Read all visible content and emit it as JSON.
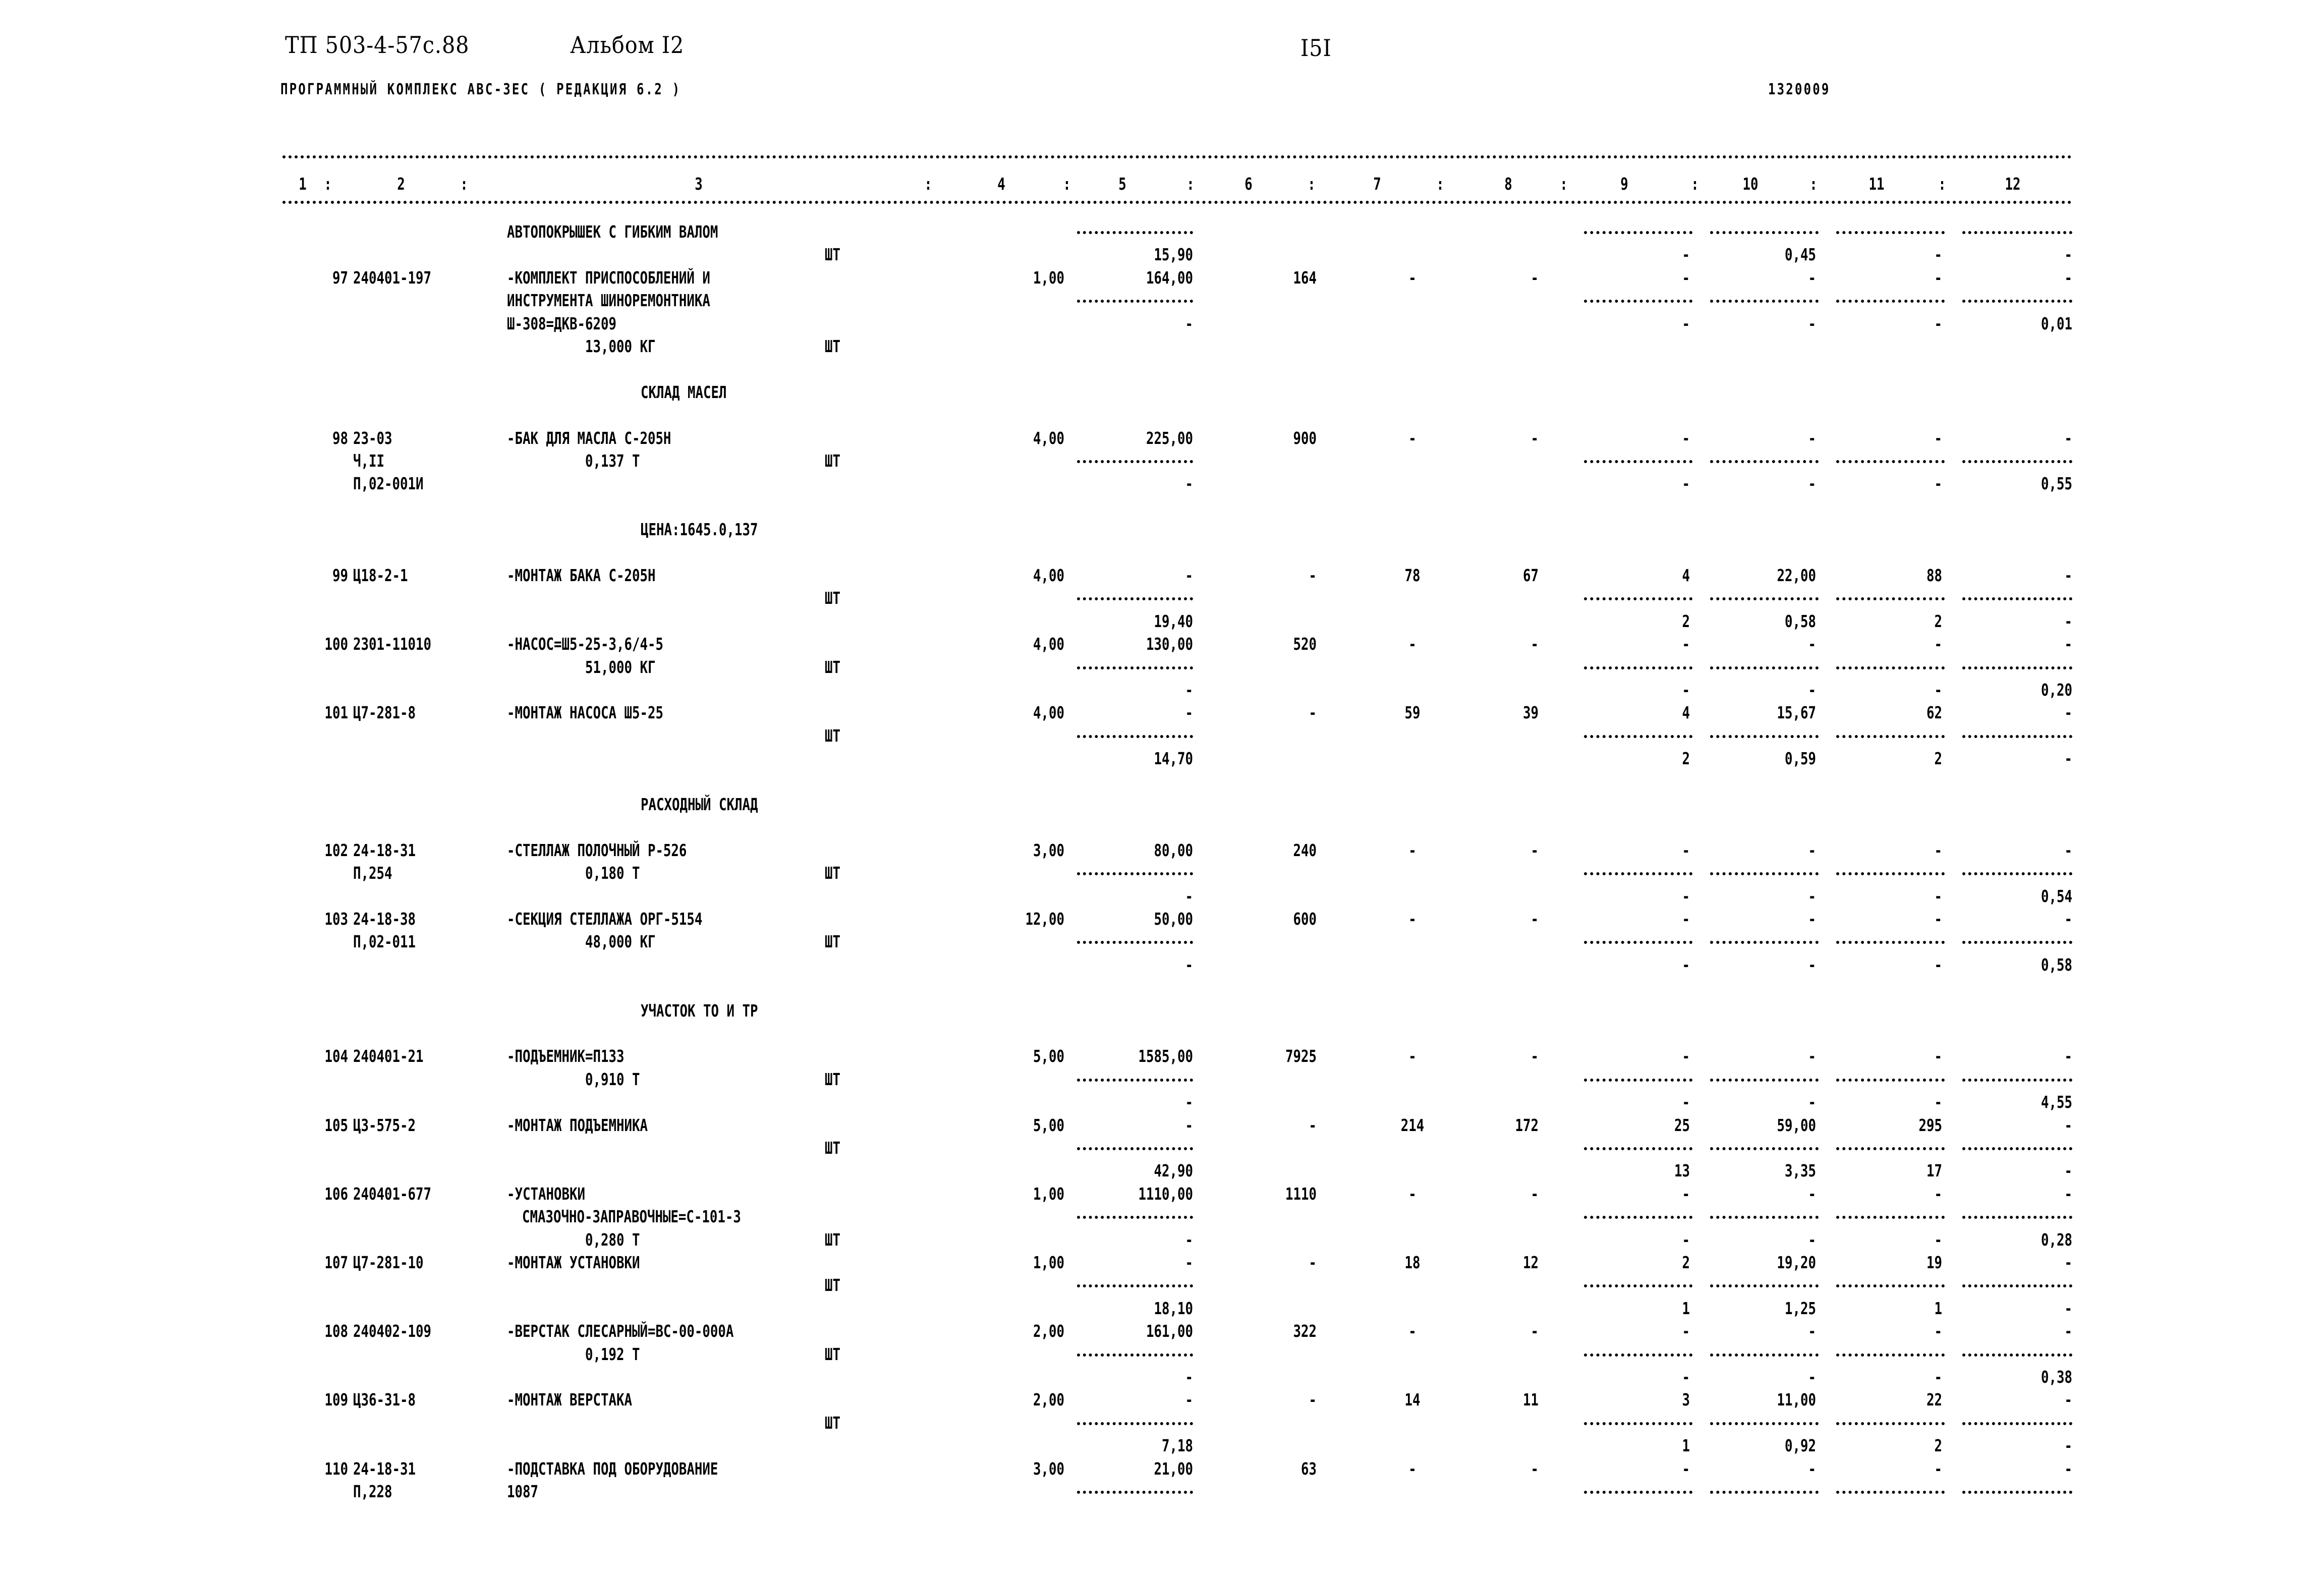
{
  "header": {
    "doc_code": "ТП 503-4-57с.88",
    "album": "Альбом I2",
    "page_number": "I5I",
    "program": "ПРОГРАММНЫЙ КОМПЛЕКС АВС-3ЕС   ( РЕДАКЦИЯ  6.2 )",
    "doc_id": "1320009"
  },
  "column_header": [
    "1",
    ":",
    "2",
    ":",
    "3",
    ":",
    "4",
    ":",
    "5",
    ":",
    "6",
    ":",
    "7",
    ":",
    "8",
    ":",
    "9",
    ":",
    "10",
    ":",
    "11",
    ":",
    "12"
  ],
  "lines": [
    {
      "L": 0,
      "c3": "АВТОПОКРЫШЕК С ГИБКИМ ВАЛОМ",
      "dash5": true,
      "dash9_12": true
    },
    {
      "L": 1,
      "unit": "ШТ",
      "c5": "15,90",
      "c10": "0,45",
      "c9": "-",
      "c11": "-",
      "c12": "-"
    },
    {
      "L": 2,
      "c1": "97",
      "c2": "240401-197",
      "c3": "-КОМПЛЕКТ ПРИСПОСОБЛЕНИЙ И",
      "c4": "1,00",
      "c5": "164,00",
      "c6": "164",
      "c7": "-",
      "c8": "-",
      "c9": "-",
      "c10": "-",
      "c11": "-",
      "c12": "-"
    },
    {
      "L": 3,
      "c3": "ИНСТРУМЕНТА ШИНОРЕМОНТНИКА",
      "dash5": true,
      "dash9_12": true
    },
    {
      "L": 4,
      "c3": "Ш-308=ДКВ-6209",
      "c5": "-",
      "c9": "-",
      "c10": "-",
      "c11": "-",
      "c12": "0,01"
    },
    {
      "L": 5,
      "c3w": "13,000 КГ",
      "unit": "ШТ"
    },
    {
      "L": 7,
      "section": "СКЛАД МАСЕЛ"
    },
    {
      "L": 9,
      "c1": "98",
      "c2": "23-03",
      "c3": "-БАК ДЛЯ МАСЛА С-205Н",
      "c4": "4,00",
      "c5": "225,00",
      "c6": "900",
      "c7": "-",
      "c8": "-",
      "c9": "-",
      "c10": "-",
      "c11": "-",
      "c12": "-"
    },
    {
      "L": 10,
      "c2": "Ч,II",
      "c3w": "0,137 Т",
      "unit": "ШТ",
      "dash5": true,
      "dash9_12": true
    },
    {
      "L": 11,
      "c2": "П,02-001И",
      "c5": "-",
      "c9": "-",
      "c10": "-",
      "c11": "-",
      "c12": "0,55"
    },
    {
      "L": 13,
      "section": "ЦЕНА:1645.0,137"
    },
    {
      "L": 15,
      "c1": "99",
      "c2": "Ц18-2-1",
      "c3": "-МОНТАЖ БАКА С-205Н",
      "c4": "4,00",
      "c5": "-",
      "c6": "-",
      "c7": "78",
      "c8": "67",
      "c9": "4",
      "c10": "22,00",
      "c11": "88",
      "c12": "-"
    },
    {
      "L": 16,
      "unit": "ШТ",
      "dash5": true,
      "dash9_12": true
    },
    {
      "L": 17,
      "c5": "19,40",
      "c9": "2",
      "c10": "0,58",
      "c11": "2",
      "c12": "-"
    },
    {
      "L": 18,
      "c1": "100",
      "c2": "2301-11010",
      "c3": "-НАСОС=Ш5-25-3,6/4-5",
      "c4": "4,00",
      "c5": "130,00",
      "c6": "520",
      "c7": "-",
      "c8": "-",
      "c9": "-",
      "c10": "-",
      "c11": "-",
      "c12": "-"
    },
    {
      "L": 19,
      "c3w": "51,000 КГ",
      "unit": "ШТ",
      "dash5": true,
      "dash9_12": true
    },
    {
      "L": 20,
      "c5": "-",
      "c9": "-",
      "c10": "-",
      "c11": "-",
      "c12": "0,20"
    },
    {
      "L": 21,
      "c1": "101",
      "c2": "Ц7-281-8",
      "c3": "-МОНТАЖ НАСОСА Ш5-25",
      "c4": "4,00",
      "c5": "-",
      "c6": "-",
      "c7": "59",
      "c8": "39",
      "c9": "4",
      "c10": "15,67",
      "c11": "62",
      "c12": "-"
    },
    {
      "L": 22,
      "unit": "ШТ",
      "dash5": true,
      "dash9_12": true
    },
    {
      "L": 23,
      "c5": "14,70",
      "c9": "2",
      "c10": "0,59",
      "c11": "2",
      "c12": "-"
    },
    {
      "L": 25,
      "section": "РАСХОДНЫЙ СКЛАД"
    },
    {
      "L": 27,
      "c1": "102",
      "c2": "24-18-31",
      "c3": "-СТЕЛЛАЖ ПОЛОЧНЫЙ Р-526",
      "c4": "3,00",
      "c5": "80,00",
      "c6": "240",
      "c7": "-",
      "c8": "-",
      "c9": "-",
      "c10": "-",
      "c11": "-",
      "c12": "-"
    },
    {
      "L": 28,
      "c2": "П,254",
      "c3w": "0,180 Т",
      "unit": "ШТ",
      "dash5": true,
      "dash9_12": true
    },
    {
      "L": 29,
      "c5": "-",
      "c9": "-",
      "c10": "-",
      "c11": "-",
      "c12": "0,54"
    },
    {
      "L": 30,
      "c1": "103",
      "c2": "24-18-38",
      "c3": "-СЕКЦИЯ СТЕЛЛАЖА ОРГ-5154",
      "c4": "12,00",
      "c5": "50,00",
      "c6": "600",
      "c7": "-",
      "c8": "-",
      "c9": "-",
      "c10": "-",
      "c11": "-",
      "c12": "-"
    },
    {
      "L": 31,
      "c2": "П,02-011",
      "c3w": "48,000 КГ",
      "unit": "ШТ",
      "dash5": true,
      "dash9_12": true
    },
    {
      "L": 32,
      "c5": "-",
      "c9": "-",
      "c10": "-",
      "c11": "-",
      "c12": "0,58"
    },
    {
      "L": 34,
      "section": "УЧАСТОК ТО И ТР"
    },
    {
      "L": 36,
      "c1": "104",
      "c2": "240401-21",
      "c3": "-ПОДЪЕМНИК=П133",
      "c4": "5,00",
      "c5": "1585,00",
      "c6": "7925",
      "c7": "-",
      "c8": "-",
      "c9": "-",
      "c10": "-",
      "c11": "-",
      "c12": "-"
    },
    {
      "L": 37,
      "c3w": "0,910 Т",
      "unit": "ШТ",
      "dash5": true,
      "dash9_12": true
    },
    {
      "L": 38,
      "c5": "-",
      "c9": "-",
      "c10": "-",
      "c11": "-",
      "c12": "4,55"
    },
    {
      "L": 39,
      "c1": "105",
      "c2": "Ц3-575-2",
      "c3": "-МОНТАЖ ПОДЪЕМНИКА",
      "c4": "5,00",
      "c5": "-",
      "c6": "-",
      "c7": "214",
      "c8": "172",
      "c9": "25",
      "c10": "59,00",
      "c11": "295",
      "c12": "-"
    },
    {
      "L": 40,
      "unit": "ШТ",
      "dash5": true,
      "dash9_12": true
    },
    {
      "L": 41,
      "c5": "42,90",
      "c9": "13",
      "c10": "3,35",
      "c11": "17",
      "c12": "-"
    },
    {
      "L": 42,
      "c1": "106",
      "c2": "240401-677",
      "c3": "-УСТАНОВКИ",
      "c4": "1,00",
      "c5": "1110,00",
      "c6": "1110",
      "c7": "-",
      "c8": "-",
      "c9": "-",
      "c10": "-",
      "c11": "-",
      "c12": "-"
    },
    {
      "L": 43,
      "c3i": "СМАЗОЧНО-ЗАПРАВОЧНЫЕ=С-101-3",
      "dash5": true,
      "dash9_12": true
    },
    {
      "L": 44,
      "c3w": "0,280 Т",
      "unit": "ШТ",
      "c5": "-",
      "c9": "-",
      "c10": "-",
      "c11": "-",
      "c12": "0,28"
    },
    {
      "L": 45,
      "c1": "107",
      "c2": "Ц7-281-10",
      "c3": "-МОНТАЖ УСТАНОВКИ",
      "c4": "1,00",
      "c5": "-",
      "c6": "-",
      "c7": "18",
      "c8": "12",
      "c9": "2",
      "c10": "19,20",
      "c11": "19",
      "c12": "-"
    },
    {
      "L": 46,
      "unit": "ШТ",
      "dash5": true,
      "dash9_12": true
    },
    {
      "L": 47,
      "c5": "18,10",
      "c9": "1",
      "c10": "1,25",
      "c11": "1",
      "c12": "-"
    },
    {
      "L": 48,
      "c1": "108",
      "c2": "240402-109",
      "c3": "-ВЕРСТАК СЛЕСАРНЫЙ=ВС-00-000А",
      "c4": "2,00",
      "c5": "161,00",
      "c6": "322",
      "c7": "-",
      "c8": "-",
      "c9": "-",
      "c10": "-",
      "c11": "-",
      "c12": "-"
    },
    {
      "L": 49,
      "c3w": "0,192 Т",
      "unit": "ШТ",
      "dash5": true,
      "dash9_12": true
    },
    {
      "L": 50,
      "c5": "-",
      "c9": "-",
      "c10": "-",
      "c11": "-",
      "c12": "0,38"
    },
    {
      "L": 51,
      "c1": "109",
      "c2": "Ц36-31-8",
      "c3": "-МОНТАЖ ВЕРСТАКА",
      "c4": "2,00",
      "c5": "-",
      "c6": "-",
      "c7": "14",
      "c8": "11",
      "c9": "3",
      "c10": "11,00",
      "c11": "22",
      "c12": "-"
    },
    {
      "L": 52,
      "unit": "ШТ",
      "dash5": true,
      "dash9_12": true
    },
    {
      "L": 53,
      "c5": "7,18",
      "c9": "1",
      "c10": "0,92",
      "c11": "2",
      "c12": "-"
    },
    {
      "L": 54,
      "c1": "110",
      "c2": "24-18-31",
      "c3": "-ПОДСТАВКА ПОД ОБОРУДОВАНИЕ",
      "c4": "3,00",
      "c5": "21,00",
      "c6": "63",
      "c7": "-",
      "c8": "-",
      "c9": "-",
      "c10": "-",
      "c11": "-",
      "c12": "-"
    },
    {
      "L": 55,
      "c2": "П,228",
      "c3": "1087",
      "dash5": true,
      "dash9_12": true
    }
  ]
}
